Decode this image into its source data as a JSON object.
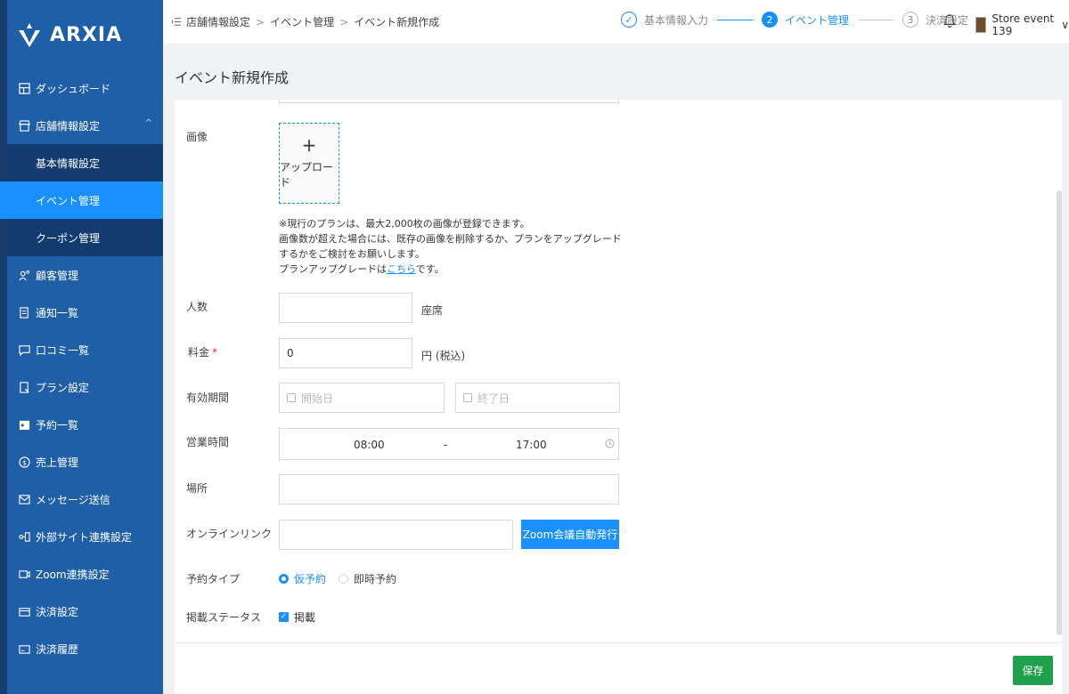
{
  "logo": {
    "text": "ARXIA"
  },
  "sidebar": {
    "items": [
      {
        "label": "ダッシュボード",
        "icon": "dashboard-icon"
      },
      {
        "label": "店舗情報設定",
        "icon": "store-icon"
      },
      {
        "label": "顧客管理",
        "icon": "customers-icon"
      },
      {
        "label": "通知一覧",
        "icon": "notification-list-icon"
      },
      {
        "label": "口コミ一覧",
        "icon": "review-icon"
      },
      {
        "label": "プラン設定",
        "icon": "plan-icon"
      },
      {
        "label": "予約一覧",
        "icon": "reservation-icon"
      },
      {
        "label": "売上管理",
        "icon": "sales-icon"
      },
      {
        "label": "メッセージ送信",
        "icon": "message-icon"
      },
      {
        "label": "外部サイト連携設定",
        "icon": "external-link-icon"
      },
      {
        "label": "Zoom連携設定",
        "icon": "zoom-icon"
      },
      {
        "label": "決済設定",
        "icon": "payment-icon"
      },
      {
        "label": "決済履歴",
        "icon": "payment-history-icon"
      }
    ],
    "submenu": [
      {
        "label": "基本情報設定",
        "active": false
      },
      {
        "label": "イベント管理",
        "active": true
      },
      {
        "label": "クーポン管理",
        "active": false
      }
    ],
    "caret": "^"
  },
  "header": {
    "breadcrumb": [
      "店舗情報設定",
      "イベント管理",
      "イベント新規作成"
    ],
    "breadcrumb_sep": ">",
    "steps": [
      {
        "num": "✓",
        "label": "基本情報入力",
        "state": "done"
      },
      {
        "num": "2",
        "label": "イベント管理",
        "state": "active"
      },
      {
        "num": "3",
        "label": "決済設定",
        "state": "wait"
      }
    ],
    "user_name": "Store event 139",
    "user_caret": "∨"
  },
  "page": {
    "title": "イベント新規作成"
  },
  "form": {
    "image_label": "画像",
    "upload_plus": "+",
    "upload_label": "アップロード",
    "note_line1": "※現行のプランは、最大2,000枚の画像が登録できます。",
    "note_line2": "画像数が超えた場合には、既存の画像を削除するか、プランをアップグレードするかをご検討をお願いします。",
    "note_line3_prefix": "プランアップグレードは",
    "note_link": "こちら",
    "note_line3_suffix": "です。",
    "capacity_label": "人数",
    "capacity_value": "",
    "capacity_suffix": "座席",
    "price_label": "料金",
    "price_required": "*",
    "price_value": "0",
    "price_suffix": "円 (税込)",
    "period_label": "有効期間",
    "start_placeholder": "開始日",
    "end_placeholder": "終了日",
    "hours_label": "営業時間",
    "hours_start": "08:00",
    "hours_sep": "-",
    "hours_end": "17:00",
    "place_label": "場所",
    "place_value": "",
    "online_label": "オンラインリンク",
    "online_value": "",
    "zoom_button": "Zoom会議自動発行",
    "reserve_type_label": "予約タイプ",
    "reserve_option1": "仮予約",
    "reserve_option2": "即時予約",
    "reserve_selected": "仮予約",
    "status_label": "掲載ステータス",
    "status_option": "掲載",
    "status_checked": true
  },
  "footer": {
    "save_label": "保存"
  },
  "colors": {
    "sidebar": "#1f5fa8",
    "active": "#1890ff",
    "save": "#1fa04d"
  }
}
